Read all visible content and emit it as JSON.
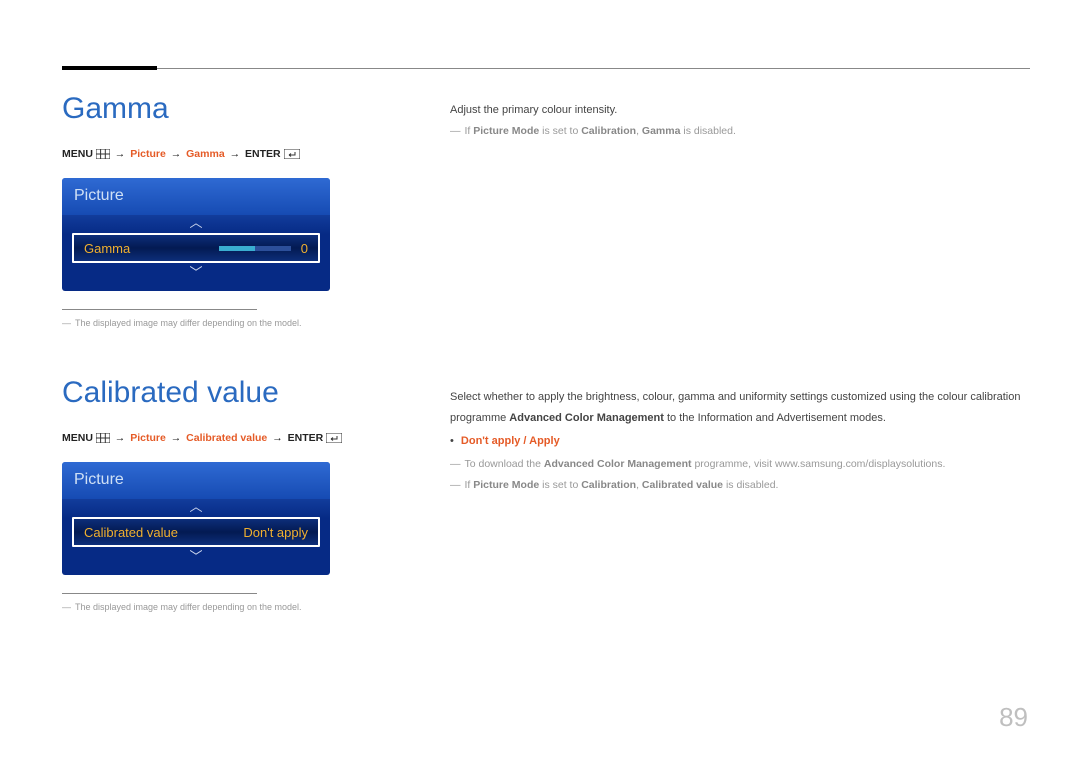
{
  "page_number": "89",
  "section_gamma": {
    "title": "Gamma",
    "nav": {
      "menu": "MENU",
      "path1": "Picture",
      "path2": "Gamma",
      "enter": "ENTER"
    },
    "osd": {
      "header": "Picture",
      "row_label": "Gamma",
      "row_value": "0"
    },
    "footnote": "The displayed image may differ depending on the model.",
    "desc_primary": "Adjust the primary colour intensity.",
    "note_prefix": "If ",
    "note_b1": "Picture Mode",
    "note_mid": " is set to ",
    "note_b2": "Calibration",
    "note_sep": ", ",
    "note_b3": "Gamma",
    "note_suffix": " is disabled."
  },
  "section_calibrated": {
    "title": "Calibrated value",
    "nav": {
      "menu": "MENU",
      "path1": "Picture",
      "path2": "Calibrated value",
      "enter": "ENTER"
    },
    "osd": {
      "header": "Picture",
      "row_label": "Calibrated value",
      "row_value": "Don't apply"
    },
    "footnote": "The displayed image may differ depending on the model.",
    "desc_line1": "Select whether to apply the brightness, colour, gamma and uniformity settings customized using the colour calibration",
    "desc_line2a": "programme ",
    "desc_line2b": "Advanced Color Management",
    "desc_line2c": " to the Information and Advertisement modes.",
    "options_a": "Don't apply",
    "options_sep": " / ",
    "options_b": "Apply",
    "dl_prefix": "To download the ",
    "dl_bold": "Advanced Color Management",
    "dl_suffix": " programme, visit www.samsung.com/displaysolutions.",
    "note_prefix": "If ",
    "note_b1": "Picture Mode",
    "note_mid": " is set to ",
    "note_b2": "Calibration",
    "note_sep": ", ",
    "note_b3": "Calibrated value",
    "note_suffix": " is disabled."
  }
}
